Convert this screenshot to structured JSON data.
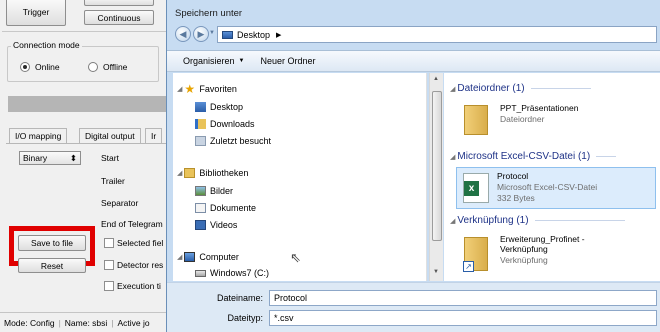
{
  "app": {
    "trigger_label": "Trigger",
    "continuous_label": "Continuous",
    "connection_mode_title": "Connection mode",
    "online_label": "Online",
    "offline_label": "Offline",
    "tabs": [
      "I/O mapping",
      "Digital output",
      "Ir"
    ],
    "format_value": "Binary",
    "rows": [
      "Start",
      "Trailer",
      "Separator",
      "End of Telegram"
    ],
    "checks": [
      "Selected fiel",
      "Detector res",
      "Execution ti"
    ],
    "save_to_file_label": "Save to file",
    "reset_label": "Reset",
    "status": [
      "Mode:  Config",
      "Name:  sbsi",
      "Active jo"
    ]
  },
  "dialog": {
    "title": "Speichern unter",
    "address": "Desktop",
    "toolbar": {
      "organize": "Organisieren",
      "new_folder": "Neuer Ordner"
    },
    "nav": {
      "favorites": "Favoriten",
      "fav_items": [
        "Desktop",
        "Downloads",
        "Zuletzt besucht"
      ],
      "libraries": "Bibliotheken",
      "lib_items": [
        "Bilder",
        "Dokumente",
        "Videos"
      ],
      "computer": "Computer",
      "drive": "Windows7 (C:)"
    },
    "groups": [
      {
        "title": "Dateiordner (1)",
        "name": "PPT_Präsentationen",
        "meta1": "Dateiordner",
        "meta2": ""
      },
      {
        "title": "Microsoft Excel-CSV-Datei (1)",
        "name": "Protocol",
        "meta1": "Microsoft Excel-CSV-Datei",
        "meta2": "332 Bytes"
      },
      {
        "title": "Verknüpfung (1)",
        "name1": "Erweiterung_Profinet -",
        "name2": "Verknüpfung",
        "meta1": "Verknüpfung"
      }
    ],
    "filename_label": "Dateiname:",
    "filename_value": "Protocol",
    "filetype_label": "Dateityp:",
    "filetype_value": "*.csv"
  },
  "colors": {
    "highlight": "#e00000",
    "dialog_bg": "#c7dcf2",
    "group_header": "#1e3287"
  }
}
